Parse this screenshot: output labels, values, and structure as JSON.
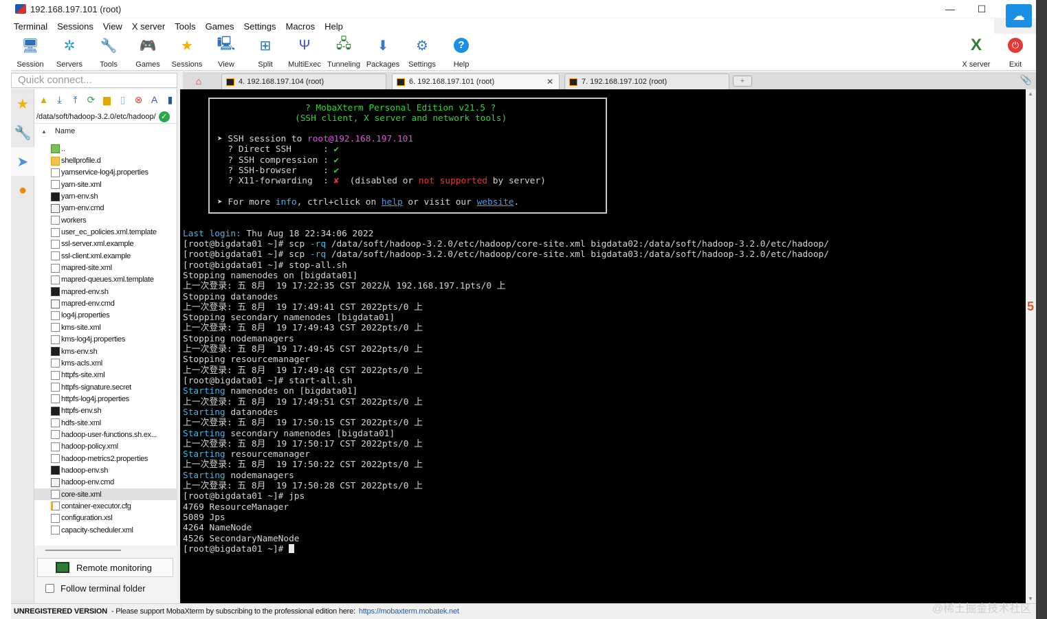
{
  "window": {
    "title": "192.168.197.101 (root)"
  },
  "menu": [
    "Terminal",
    "Sessions",
    "View",
    "X server",
    "Tools",
    "Games",
    "Settings",
    "Macros",
    "Help"
  ],
  "toolbar": {
    "session": "Session",
    "servers": "Servers",
    "tools": "Tools",
    "games": "Games",
    "sessions": "Sessions",
    "view": "View",
    "split": "Split",
    "multiexec": "MultiExec",
    "tunneling": "Tunneling",
    "packages": "Packages",
    "settings": "Settings",
    "help": "Help",
    "xserver": "X server",
    "exit": "Exit"
  },
  "quick_connect": {
    "placeholder": "Quick connect..."
  },
  "tabs": [
    {
      "label": "4. 192.168.197.104 (root)"
    },
    {
      "label": "6. 192.168.197.101 (root)"
    },
    {
      "label": "7. 192.168.197.102 (root)"
    }
  ],
  "sftp": {
    "path": "/data/soft/hadoop-3.2.0/etc/hadoop/",
    "name_header": "Name",
    "files": [
      {
        "name": "..",
        "type": "up"
      },
      {
        "name": "shellprofile.d",
        "type": "folder"
      },
      {
        "name": "yarnservice-log4j.properties",
        "type": "doc"
      },
      {
        "name": "yarn-site.xml",
        "type": "doc"
      },
      {
        "name": "yarn-env.sh",
        "type": "term"
      },
      {
        "name": "yarn-env.cmd",
        "type": "cmd"
      },
      {
        "name": "workers",
        "type": "doc"
      },
      {
        "name": "user_ec_policies.xml.template",
        "type": "doc"
      },
      {
        "name": "ssl-server.xml.example",
        "type": "doc"
      },
      {
        "name": "ssl-client.xml.example",
        "type": "doc"
      },
      {
        "name": "mapred-site.xml",
        "type": "doc"
      },
      {
        "name": "mapred-queues.xml.template",
        "type": "doc"
      },
      {
        "name": "mapred-env.sh",
        "type": "term"
      },
      {
        "name": "mapred-env.cmd",
        "type": "cmd"
      },
      {
        "name": "log4j.properties",
        "type": "doc"
      },
      {
        "name": "kms-site.xml",
        "type": "doc"
      },
      {
        "name": "kms-log4j.properties",
        "type": "doc"
      },
      {
        "name": "kms-env.sh",
        "type": "term"
      },
      {
        "name": "kms-acls.xml",
        "type": "doc"
      },
      {
        "name": "httpfs-site.xml",
        "type": "doc"
      },
      {
        "name": "httpfs-signature.secret",
        "type": "doc"
      },
      {
        "name": "httpfs-log4j.properties",
        "type": "doc"
      },
      {
        "name": "httpfs-env.sh",
        "type": "term"
      },
      {
        "name": "hdfs-site.xml",
        "type": "doc"
      },
      {
        "name": "hadoop-user-functions.sh.ex...",
        "type": "doc"
      },
      {
        "name": "hadoop-policy.xml",
        "type": "doc"
      },
      {
        "name": "hadoop-metrics2.properties",
        "type": "doc"
      },
      {
        "name": "hadoop-env.sh",
        "type": "term"
      },
      {
        "name": "hadoop-env.cmd",
        "type": "cmd"
      },
      {
        "name": "core-site.xml",
        "type": "doc",
        "selected": true
      },
      {
        "name": "container-executor.cfg",
        "type": "cfg"
      },
      {
        "name": "configuration.xsl",
        "type": "doc"
      },
      {
        "name": "capacity-scheduler.xml",
        "type": "doc"
      }
    ],
    "remote_monitoring": "Remote monitoring",
    "follow_folder": "Follow terminal folder"
  },
  "banner": {
    "title": "? MobaXterm Personal Edition v21.5 ?",
    "subtitle": "(SSH client, X server and network tools)",
    "ssh_prefix": "➤ SSH session to ",
    "ssh_target": "root@192.168.197.101",
    "direct_ssh": "  ? Direct SSH      :",
    "compression": "  ? SSH compression :",
    "browser": "  ? SSH-browser     :",
    "x11": "  ? X11-forwarding  :",
    "check": "✔",
    "cross": "✘",
    "x11_p1": "(disabled ",
    "x11_or": "or",
    "x11_not": "not supported",
    "x11_p2": "by server)",
    "more_p1": "➤ For more ",
    "more_info": "info",
    "more_p2": ", ctrl+click on ",
    "more_help": "help",
    "more_p3": " or visit our ",
    "more_site": "website",
    "more_dot": "."
  },
  "terminal": {
    "last_login_label": "Last login:",
    "last_login_value": " Thu Aug 18 22:34:06 2022",
    "prompt": "[root@bigdata01 ~]# ",
    "scp": "scp ",
    "rq": "-rq",
    "scp_cmd1": " /data/soft/hadoop-3.2.0/etc/hadoop/core-site.xml bigdata02:/data/soft/hadoop-3.2.0/etc/hadoop/",
    "scp_cmd2": " /data/soft/hadoop-3.2.0/etc/hadoop/core-site.xml bigdata03:/data/soft/hadoop-3.2.0/etc/hadoop/",
    "stop_all": "stop-all.sh",
    "stop_nn": "Stopping namenodes on [bigdata01]",
    "login1": "上一次登录: 五 8月  19 17:22:35 CST 2022从 192.168.197.1pts/0 上",
    "stop_dn": "Stopping datanodes",
    "login2": "上一次登录: 五 8月  19 17:49:41 CST 2022pts/0 上",
    "stop_snn": "Stopping secondary namenodes [bigdata01]",
    "login3": "上一次登录: 五 8月  19 17:49:43 CST 2022pts/0 上",
    "stop_nm": "Stopping nodemanagers",
    "login4": "上一次登录: 五 8月  19 17:49:45 CST 2022pts/0 上",
    "stop_rm": "Stopping resourcemanager",
    "login5": "上一次登录: 五 8月  19 17:49:48 CST 2022pts/0 上",
    "start_all": "start-all.sh",
    "starting": "Starting",
    "start_nn": " namenodes on [bigdata01]",
    "login6": "上一次登录: 五 8月  19 17:49:51 CST 2022pts/0 上",
    "start_dn": " datanodes",
    "login7": "上一次登录: 五 8月  19 17:50:15 CST 2022pts/0 上",
    "start_snn": " secondary namenodes [bigdata01]",
    "login8": "上一次登录: 五 8月  19 17:50:17 CST 2022pts/0 上",
    "start_rm": " resourcemanager",
    "login9": "上一次登录: 五 8月  19 17:50:22 CST 2022pts/0 上",
    "start_nm": " nodemanagers",
    "login10": "上一次登录: 五 8月  19 17:50:28 CST 2022pts/0 上",
    "jps": "jps",
    "p1": "4769 ResourceManager",
    "p2": "5089 Jps",
    "p3": "4264 NameNode",
    "p4": "4526 SecondaryNameNode"
  },
  "status": {
    "unregistered": "UNREGISTERED VERSION",
    "message": "-  Please support MobaXterm by subscribing to the professional edition here:",
    "link": "https://mobaxterm.mobatek.net"
  },
  "watermark": "@稀土掘金技术社区"
}
